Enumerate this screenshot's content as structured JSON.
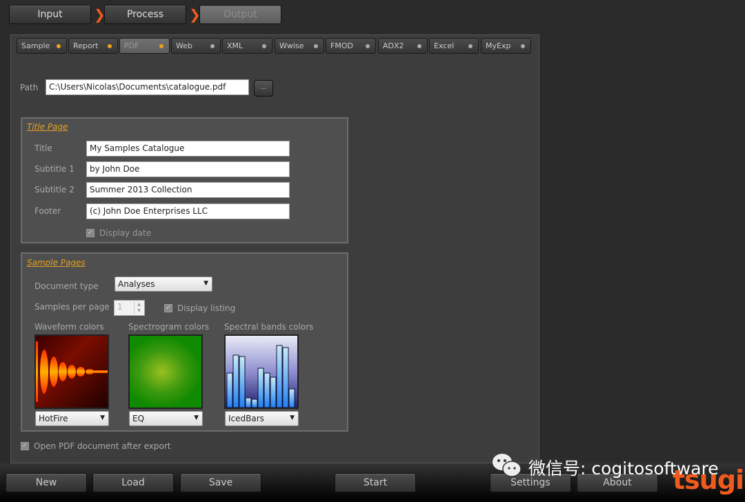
{
  "steps": [
    "Input",
    "Process",
    "Output"
  ],
  "tabs": [
    {
      "label": "Sample",
      "dot": "on"
    },
    {
      "label": "Report",
      "dot": "on"
    },
    {
      "label": "PDF",
      "dot": "on"
    },
    {
      "label": "Web",
      "dot": "off"
    },
    {
      "label": "XML",
      "dot": "off"
    },
    {
      "label": "Wwise",
      "dot": "off"
    },
    {
      "label": "FMOD",
      "dot": "off"
    },
    {
      "label": "ADX2",
      "dot": "off"
    },
    {
      "label": "Excel",
      "dot": "off"
    },
    {
      "label": "MyExp",
      "dot": "off"
    }
  ],
  "active_tab": "PDF",
  "path": {
    "label": "Path",
    "value": "C:\\Users\\Nicolas\\Documents\\catalogue.pdf",
    "browse": "..."
  },
  "title_page": {
    "heading": "Title Page",
    "title_label": "Title",
    "title": "My Samples Catalogue",
    "subtitle1_label": "Subtitle 1",
    "subtitle1": "by John Doe",
    "subtitle2_label": "Subtitle 2",
    "subtitle2": "Summer 2013 Collection",
    "footer_label": "Footer",
    "footer": "(c) John Doe Enterprises LLC",
    "display_date": "Display date"
  },
  "sample_pages": {
    "heading": "Sample Pages",
    "doc_type_label": "Document type",
    "doc_type": "Analyses",
    "spp_label": "Samples per page",
    "spp": "1",
    "display_listing": "Display listing",
    "waveform_label": "Waveform colors",
    "waveform": "HotFire",
    "spectrogram_label": "Spectrogram colors",
    "spectrogram": "EQ",
    "bands_label": "Spectral bands colors",
    "bands": "IcedBars"
  },
  "open_after": "Open PDF document after export",
  "buttons": {
    "new": "New",
    "load": "Load",
    "save": "Save",
    "start": "Start",
    "settings": "Settings",
    "about": "About"
  },
  "watermark": "微信号: cogitosoftware",
  "logo": "tsugi",
  "colors": {
    "accent": "#f05a1e",
    "heading": "#e6a020"
  }
}
